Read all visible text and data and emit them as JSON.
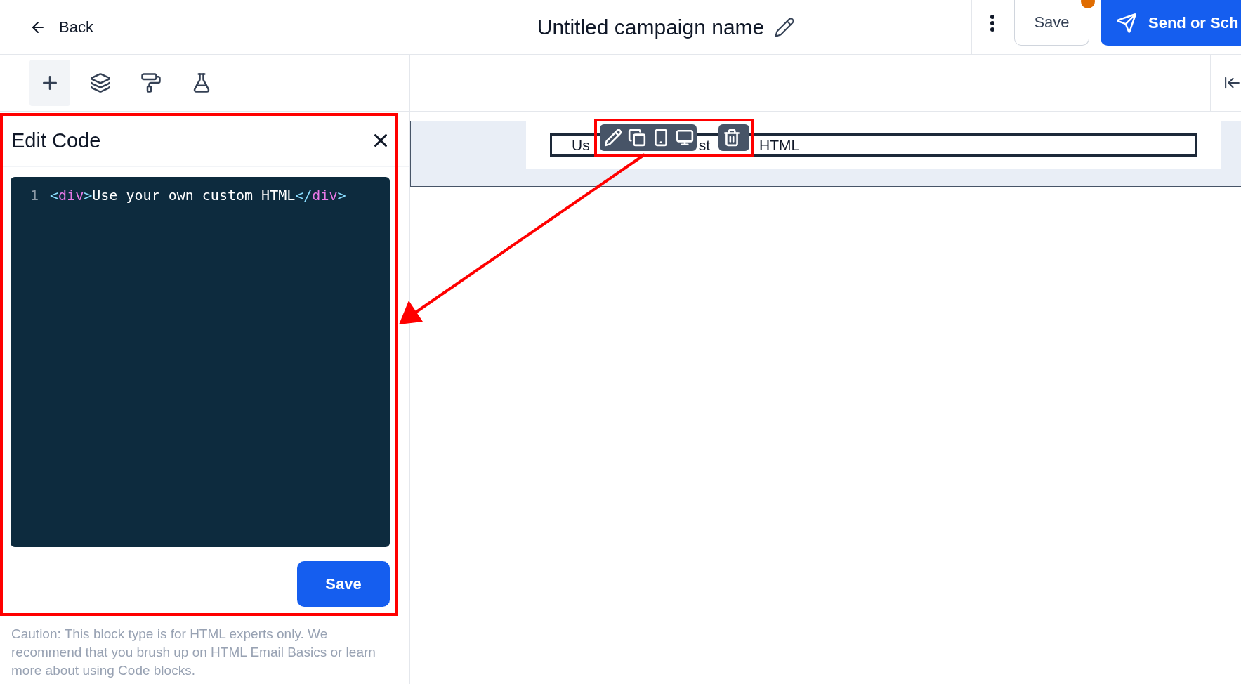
{
  "header": {
    "back": "Back",
    "title": "Untitled campaign name",
    "save": "Save",
    "save_unsaved": true,
    "send": "Send or Sch"
  },
  "tools": [
    {
      "kind": "add",
      "selected": true
    },
    {
      "kind": "layers",
      "selected": false
    },
    {
      "kind": "style",
      "selected": false
    },
    {
      "kind": "test",
      "selected": false
    }
  ],
  "edit_panel": {
    "title": "Edit Code",
    "line_number": "1",
    "tokens": [
      {
        "kind": "punct",
        "text": "<"
      },
      {
        "kind": "tag",
        "text": "div"
      },
      {
        "kind": "punct",
        "text": ">"
      },
      {
        "kind": "text",
        "text": "Use your own custom HTML"
      },
      {
        "kind": "punct",
        "text": "</"
      },
      {
        "kind": "tag",
        "text": "div"
      },
      {
        "kind": "punct",
        "text": ">"
      }
    ],
    "save": "Save",
    "caution": "Caution: This block type is for HTML experts only. We recommend that you brush up on HTML Email Basics or learn more about using Code blocks."
  },
  "canvas": {
    "block_fragments": [
      "Us",
      "st",
      "HTML"
    ],
    "block_actions": [
      {
        "kind": "edit"
      },
      {
        "kind": "duplicate"
      },
      {
        "kind": "mobile"
      },
      {
        "kind": "desktop"
      },
      {
        "kind": "delete"
      }
    ]
  }
}
